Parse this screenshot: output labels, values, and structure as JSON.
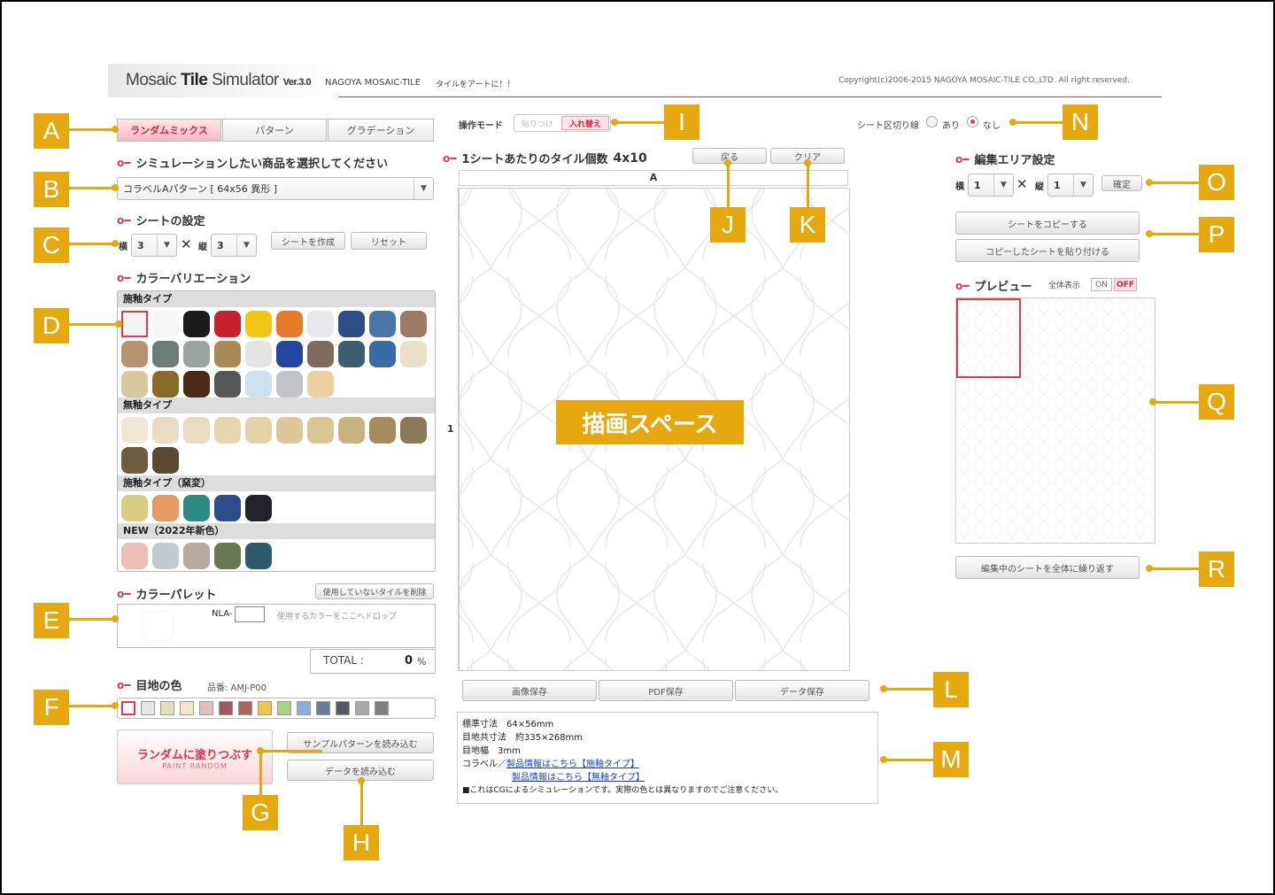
{
  "header": {
    "app_name_a": "Mosaic ",
    "app_name_b": "Tile",
    "app_name_c": " Simulator ",
    "version": "Ver.3.0",
    "company": "NAGOYA MOSAIC-TILE",
    "tagline": "タイルをアートに！！",
    "copyright": "Copyright(c)2006-2015 NAGOYA MOSAIC-TILE CO.,LTD. All right reserved."
  },
  "badges": [
    "A",
    "B",
    "C",
    "D",
    "E",
    "F",
    "G",
    "H",
    "I",
    "J",
    "K",
    "L",
    "M",
    "N",
    "O",
    "P",
    "Q",
    "R"
  ],
  "tabs": [
    {
      "label": "ランダムミックス",
      "active": true
    },
    {
      "label": "パターン",
      "active": false
    },
    {
      "label": "グラデーション",
      "active": false
    }
  ],
  "product": {
    "heading": "シミュレーションしたい商品を選択してください",
    "selected": "コラベルAパターン [ 64x56 異形 ]"
  },
  "sheet": {
    "heading": "シートの設定",
    "yoko_label": "横",
    "yoko_value": "3",
    "tate_label": "縦",
    "tate_value": "3",
    "times": "✕",
    "create_label": "シートを作成",
    "reset_label": "リセット"
  },
  "color_variation": {
    "heading": "カラーバリエーション",
    "categories": [
      {
        "name": "施釉タイプ",
        "colors": [
          "#f4f4f4",
          "#f7f7f7",
          "#1b1b1d",
          "#c8202c",
          "#f0c617",
          "#e8782a",
          "#e6e8ea",
          "#2c4d86",
          "#4a77a8",
          "#9c7a64",
          "#b59371",
          "#6c7c76",
          "#9aa39c",
          "#a88a52",
          "#e4e4e4",
          "#2446a0",
          "#7c6a5c",
          "#3a6070",
          "#3a6aa8",
          "#e8e0c8",
          "#d8c8a0",
          "#8a6a2a",
          "#4a2a14",
          "#555858",
          "#d0e0ec",
          "#c0c4c8",
          "#e8d0a0"
        ]
      },
      {
        "name": "無釉タイプ",
        "colors": [
          "#f0e8d6",
          "#e8dcc4",
          "#e8dcc0",
          "#e6d6b0",
          "#e4d2a6",
          "#dcc898",
          "#d8c694",
          "#c8b280",
          "#a48c5c",
          "#8a7a5a",
          "#6e5c40",
          "#5a4a34"
        ]
      },
      {
        "name": "施釉タイプ（窯変）",
        "colors": [
          "#d8cc80",
          "#e49a60",
          "#2c8a84",
          "#2c4c8c",
          "#20242a"
        ]
      },
      {
        "name": "NEW（2022年新色）",
        "colors": [
          "#ecc0b4",
          "#c0ccce",
          "#b4aaa0",
          "#6a7852",
          "#2e5a70"
        ]
      }
    ]
  },
  "palette": {
    "heading": "カラーパレット",
    "delete_unused_label": "使用していないタイルを削除",
    "prefix": "NLA-",
    "drop_hint": "使用するカラーをここへドロップ",
    "total_label": "TOTAL :",
    "total_value": "0",
    "total_unit": "%"
  },
  "grout": {
    "heading": "目地の色",
    "code_label": "品番: AMJ-P00",
    "colors": [
      "#ffffff",
      "#e6e6e6",
      "#e8ddb4",
      "#f4e6cc",
      "#d8c4bc",
      "#a0595c",
      "#a8665a",
      "#e8c84a",
      "#a4d480",
      "#8aaee0",
      "#6c7c94",
      "#555a60",
      "#a8a8a8",
      "#808080"
    ]
  },
  "actions": {
    "paint_random_label": "ランダムに塗りつぶす",
    "paint_random_sub": "PAINT RANDOM",
    "load_sample_label": "サンプルパターンを読み込む",
    "load_data_label": "データを読み込む"
  },
  "mode": {
    "label": "操作モード",
    "paste_label": "貼りつけ",
    "swap_label": "入れ替え"
  },
  "tiles": {
    "heading": "1シートあたりのタイル個数",
    "count": "4x10",
    "back_label": "戻る",
    "clear_label": "クリア",
    "col_header": "A",
    "row_header": "1",
    "draw_space": "描画スペース"
  },
  "save": {
    "image_label": "画像保存",
    "pdf_label": "PDF保存",
    "data_label": "データ保存"
  },
  "info": {
    "line1": "標準寸法　64×56mm",
    "line2": "目地共寸法　約335×268mm",
    "line3": "目地幅　3mm",
    "line4_prefix": "コラベル／",
    "link1": "製品情報はこちら【施釉タイプ】",
    "link2": "製品情報はこちら【無釉タイプ】",
    "note": "■これはCGによるシミュレーションです。実際の色とは異なりますのでご注意ください。"
  },
  "sheet_divider": {
    "label": "シート区切り線",
    "on_label": "あり",
    "off_label": "なし",
    "selected": "なし"
  },
  "edit_area": {
    "heading": "編集エリア設定",
    "yoko_label": "横",
    "yoko_value": "1",
    "tate_label": "縦",
    "tate_value": "1",
    "times": "✕",
    "confirm_label": "確定",
    "copy_sheet_label": "シートをコピーする",
    "paste_sheet_label": "コピーしたシートを貼り付ける"
  },
  "preview": {
    "heading": "プレビュー",
    "full_label": "全体表示",
    "on_label": "ON",
    "off_label": "OFF",
    "repeat_label": "編集中のシートを全体に繰り返す"
  }
}
